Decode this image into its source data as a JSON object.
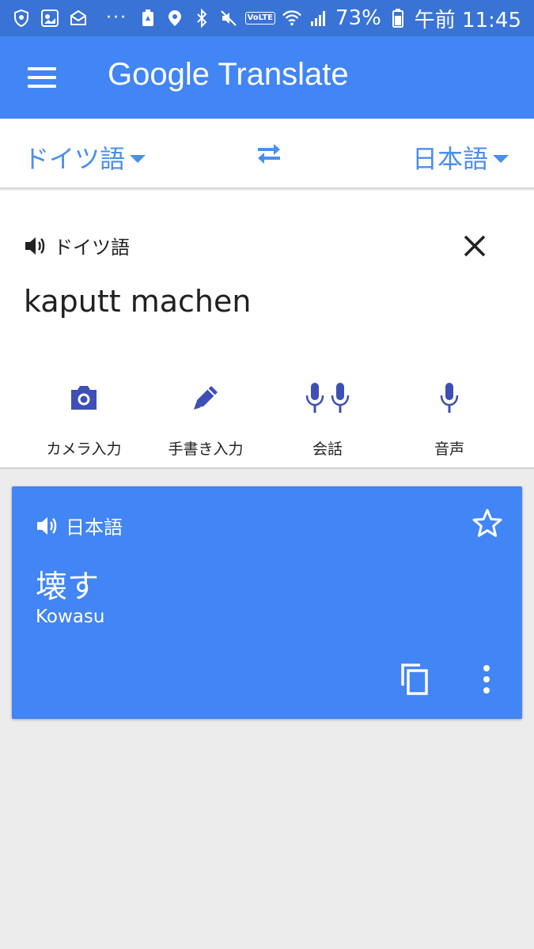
{
  "status_bar": {
    "dots": "···",
    "volte": "VoLTE",
    "battery_percent": "73%",
    "time": "午前 11:45"
  },
  "app_bar": {
    "title_google": "Google",
    "title_translate": "Translate"
  },
  "languages": {
    "source": "ドイツ語",
    "target": "日本語"
  },
  "input_card": {
    "source_label": "ドイツ語",
    "text": "kaputt machen",
    "tools": [
      {
        "label": "カメラ入力",
        "icon": "camera-icon"
      },
      {
        "label": "手書き入力",
        "icon": "pen-icon"
      },
      {
        "label": "会話",
        "icon": "dual-mic-icon"
      },
      {
        "label": "音声",
        "icon": "mic-icon"
      }
    ]
  },
  "result_card": {
    "target_label": "日本語",
    "translation": "壊す",
    "romanization": "Kowasu"
  },
  "colors": {
    "app_bar": "#4285f4",
    "status_bar": "#3a73d6",
    "accent_text": "#4a8ef0",
    "tool_icon": "#3e50b4",
    "background": "#ececec"
  }
}
